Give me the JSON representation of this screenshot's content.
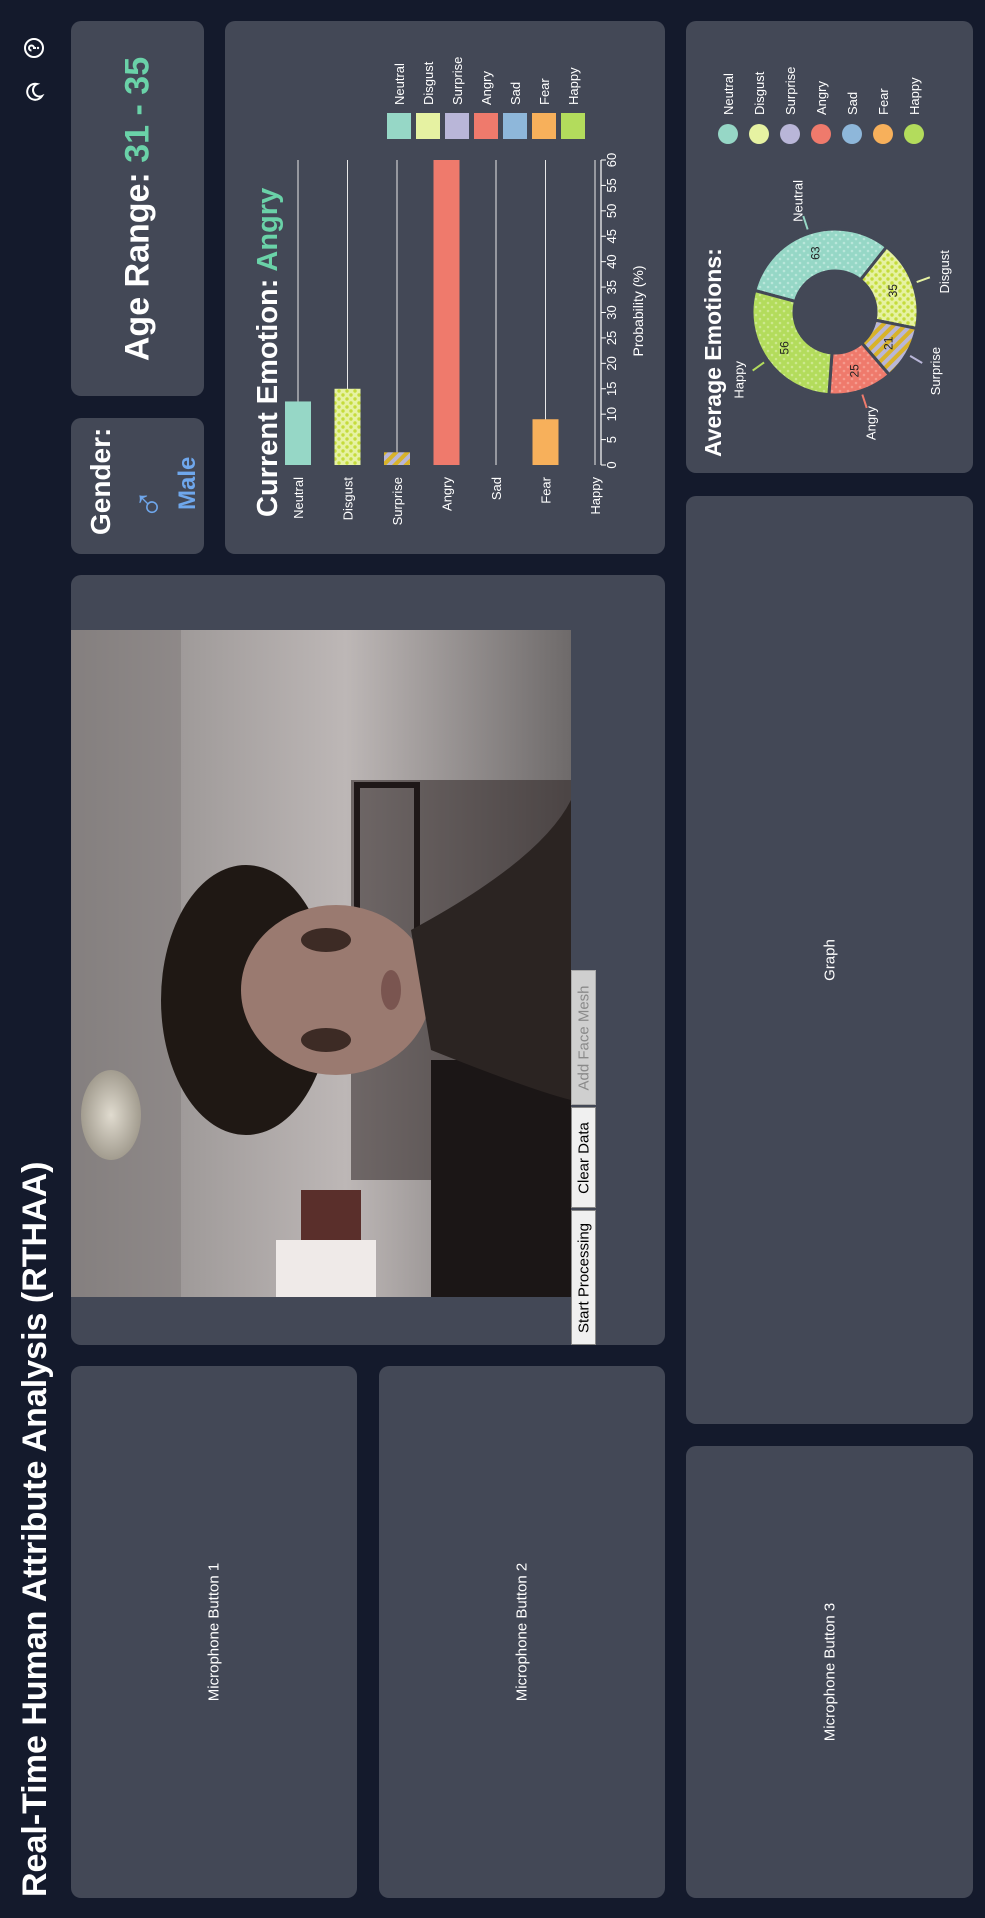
{
  "app": {
    "title": "Real-Time Human Attribute Analysis (RTHAA)"
  },
  "header_icons": [
    "moon-icon",
    "help-icon"
  ],
  "age": {
    "label": "Age Range:",
    "value": "31 - 35"
  },
  "gender": {
    "label": "Gender:",
    "symbol": "♂",
    "value": "Male"
  },
  "current_emotion": {
    "label": "Current Emotion:",
    "value": "Angry"
  },
  "camera": {
    "buttons": {
      "start": "Start Processing",
      "clear": "Clear Data",
      "face_mesh": "Add Face Mesh"
    }
  },
  "placeholders": {
    "mic1": "Microphone Button 1",
    "mic2": "Microphone Button 2",
    "mic3": "Microphone Button 3",
    "graph": "Graph"
  },
  "average_emotions": {
    "label": "Average Emotions:"
  },
  "colors": {
    "Neutral": "#96d7c6",
    "Disgust": "#e6f2a2",
    "Surprise": "#b9b6d8",
    "Angry": "#ef7a6c",
    "Sad": "#8eb7da",
    "Fear": "#f7b05b",
    "Happy": "#b3dc5c"
  },
  "chart_data": [
    {
      "type": "bar",
      "orientation": "horizontal",
      "categories": [
        "Neutral",
        "Disgust",
        "Surprise",
        "Angry",
        "Sad",
        "Fear",
        "Happy"
      ],
      "values": [
        12.5,
        15,
        2.5,
        60,
        0,
        9,
        0
      ],
      "xlabel": "Probability (%)",
      "xticks": [
        "0",
        "5",
        "10",
        "15",
        "20",
        "25",
        "30",
        "35",
        "40",
        "45",
        "50",
        "55",
        "60"
      ],
      "xlim": [
        0,
        60
      ],
      "legend": [
        "Neutral",
        "Disgust",
        "Surprise",
        "Angry",
        "Sad",
        "Fear",
        "Happy"
      ],
      "grid": true
    },
    {
      "type": "pie",
      "style": "doughnut",
      "slices": [
        {
          "label": "Neutral",
          "value": 63
        },
        {
          "label": "Disgust",
          "value": 35
        },
        {
          "label": "Surprise",
          "value": 21
        },
        {
          "label": "Angry",
          "value": 25
        },
        {
          "label": "Happy",
          "value": 56
        }
      ],
      "legend": [
        "Neutral",
        "Disgust",
        "Surprise",
        "Angry",
        "Sad",
        "Fear",
        "Happy"
      ]
    }
  ]
}
